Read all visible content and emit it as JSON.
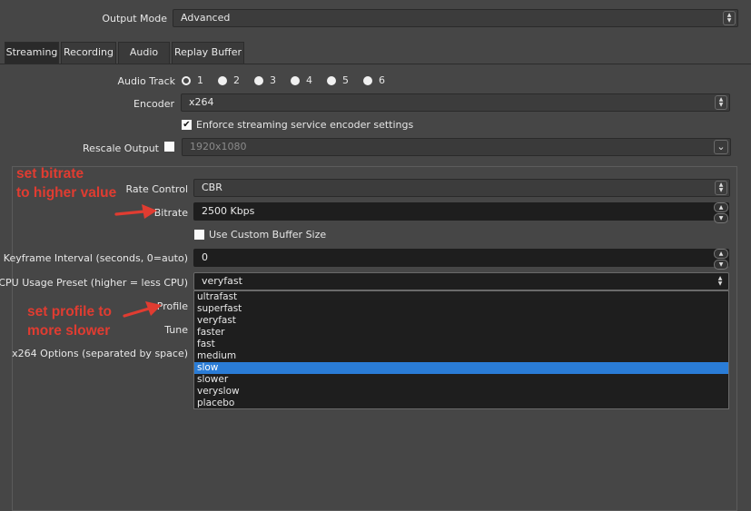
{
  "output_mode": {
    "label": "Output Mode",
    "value": "Advanced"
  },
  "tabs": [
    {
      "label": "Streaming",
      "active": true
    },
    {
      "label": "Recording",
      "active": false
    },
    {
      "label": "Audio",
      "active": false
    },
    {
      "label": "Replay Buffer",
      "active": false
    }
  ],
  "audio_track": {
    "label": "Audio Track",
    "options": [
      "1",
      "2",
      "3",
      "4",
      "5",
      "6"
    ],
    "selected": "1"
  },
  "encoder": {
    "label": "Encoder",
    "value": "x264"
  },
  "enforce": {
    "label": "Enforce streaming service encoder settings",
    "checked": true
  },
  "rescale": {
    "label": "Rescale Output",
    "checked": false,
    "value": "1920x1080"
  },
  "rate_control": {
    "label": "Rate Control",
    "value": "CBR"
  },
  "bitrate": {
    "label": "Bitrate",
    "value": "2500 Kbps"
  },
  "custom_buffer": {
    "label": "Use Custom Buffer Size",
    "checked": false
  },
  "keyframe": {
    "label": "Keyframe Interval (seconds, 0=auto)",
    "value": "0"
  },
  "cpu_preset": {
    "label": "CPU Usage Preset (higher = less CPU)",
    "value": "veryfast",
    "options": [
      "ultrafast",
      "superfast",
      "veryfast",
      "faster",
      "fast",
      "medium",
      "slow",
      "slower",
      "veryslow",
      "placebo"
    ],
    "highlighted": "slow"
  },
  "profile": {
    "label": "Profile"
  },
  "tune": {
    "label": "Tune"
  },
  "x264_options": {
    "label": "x264 Options (separated by space)"
  },
  "annotations": {
    "bitrate_note_line1": "set bitrate",
    "bitrate_note_line2": "to higher value",
    "profile_note_line1": "set profile to",
    "profile_note_line2": "more slower",
    "color": "#e03c31"
  },
  "colors": {
    "background": "#464646",
    "input_dark": "#1e1e1e",
    "highlight": "#2a7cd6"
  }
}
